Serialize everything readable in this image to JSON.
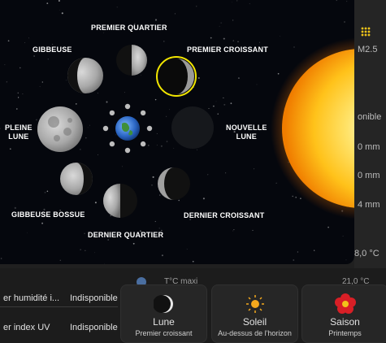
{
  "background": {
    "right_values": [
      "M2.5",
      "onible",
      "0 mm",
      "0 mm",
      "4 mm",
      "8,0 °C"
    ],
    "rows": [
      {
        "label": "er humidité i...",
        "value": "Indisponible"
      },
      {
        "label": "er index UV",
        "value": "Indisponible"
      }
    ],
    "line_top": {
      "label": "T°C maxi",
      "value": "21,0 °C"
    }
  },
  "tiles": [
    {
      "title": "Lune",
      "subtitle": "Premier croissant",
      "icon": "moon-icon"
    },
    {
      "title": "Soleil",
      "subtitle": "Au-dessus de l'horizon",
      "icon": "sun-icon"
    },
    {
      "title": "Saison",
      "subtitle": "Printemps",
      "icon": "flower-icon"
    }
  ],
  "moon_phases": {
    "premier_quartier": "PREMIER QUARTIER",
    "gibbeuse": "GIBBEUSE",
    "premier_croissant": "PREMIER CROISSANT",
    "pleine_lune": "PLEINE\nLUNE",
    "nouvelle_lune": "NOUVELLE\nLUNE",
    "gibbeuse_bossue": "GIBBEUSE BOSSUE",
    "dernier_croissant": "DERNIER CROISSANT",
    "dernier_quartier": "DERNIER QUARTIER",
    "current_phase": "PREMIER CROISSANT",
    "highlight_color": "#f2e600"
  },
  "colors": {
    "accent": "#f0c419",
    "sun": "#ffd21e",
    "popup_bg": "#05070d"
  }
}
